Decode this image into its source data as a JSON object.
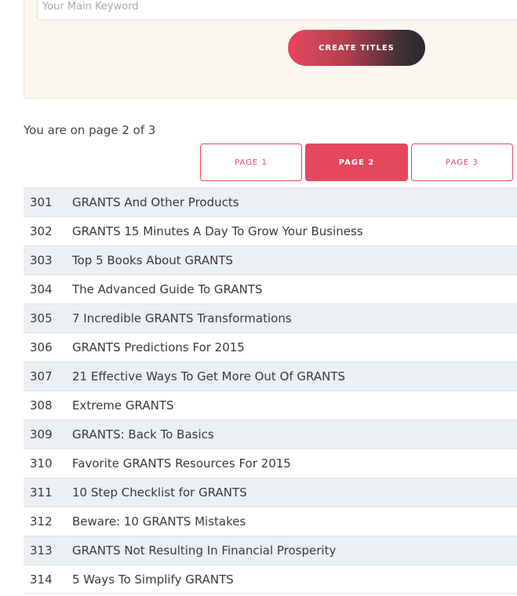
{
  "form": {
    "keyword_placeholder": "Your Main Keyword",
    "create_label": "CREATE TITLES"
  },
  "pagination": {
    "info": "You are on page 2 of 3",
    "pages": [
      {
        "label": "PAGE 1",
        "active": false
      },
      {
        "label": "PAGE 2",
        "active": true
      },
      {
        "label": "PAGE 3",
        "active": false
      }
    ]
  },
  "results": [
    {
      "num": "301",
      "title": "GRANTS And Other Products"
    },
    {
      "num": "302",
      "title": "GRANTS 15 Minutes A Day To Grow Your Business"
    },
    {
      "num": "303",
      "title": "Top 5 Books About GRANTS"
    },
    {
      "num": "304",
      "title": "The Advanced Guide To GRANTS"
    },
    {
      "num": "305",
      "title": "7 Incredible GRANTS Transformations"
    },
    {
      "num": "306",
      "title": "GRANTS Predictions For 2015"
    },
    {
      "num": "307",
      "title": "21 Effective Ways To Get More Out Of GRANTS"
    },
    {
      "num": "308",
      "title": "Extreme GRANTS"
    },
    {
      "num": "309",
      "title": "GRANTS: Back To Basics"
    },
    {
      "num": "310",
      "title": "Favorite GRANTS Resources For 2015"
    },
    {
      "num": "311",
      "title": "10 Step Checklist for GRANTS"
    },
    {
      "num": "312",
      "title": "Beware: 10 GRANTS Mistakes"
    },
    {
      "num": "313",
      "title": "GRANTS Not Resulting In Financial Prosperity"
    },
    {
      "num": "314",
      "title": "5 Ways To Simplify GRANTS"
    }
  ],
  "colors": {
    "accent": "#e5475d",
    "panel_bg": "#fbf6ef",
    "row_alt": "#eceff3"
  }
}
